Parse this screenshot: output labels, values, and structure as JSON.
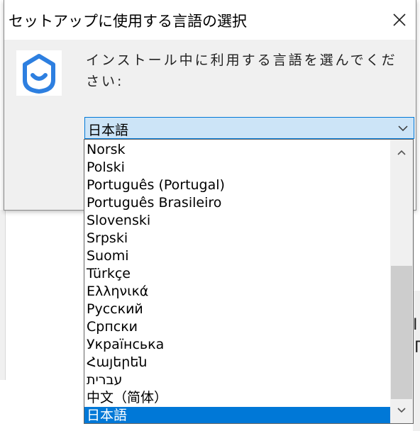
{
  "background": {
    "glyph_1": "I",
    "glyph_2": "Γ"
  },
  "dialog": {
    "title": "セットアップに使用する言語の選択",
    "close_icon": "close-icon",
    "prompt": "インストール中に利用する言語を選んでください:",
    "logo_icon": "smile-shield-logo",
    "accent_color": "#0078d7",
    "logo_color": "#2d7fe0"
  },
  "language_select": {
    "selected_value": "日本語",
    "chevron_icon": "chevron-down-icon"
  },
  "dropdown": {
    "options": [
      "Norsk",
      "Polski",
      "Português (Portugal)",
      "Português Brasileiro",
      "Slovenski",
      "Srpski",
      "Suomi",
      "Türkçe",
      "Ελληνικά",
      "Русский",
      "Српски",
      "Українська",
      "Հայերեն",
      "עברית",
      "中文（简体）",
      "日本語"
    ],
    "selected_index": 15,
    "scroll_up_icon": "chevron-up-icon",
    "scroll_down_icon": "chevron-down-icon",
    "scroll_position": 0.78
  }
}
